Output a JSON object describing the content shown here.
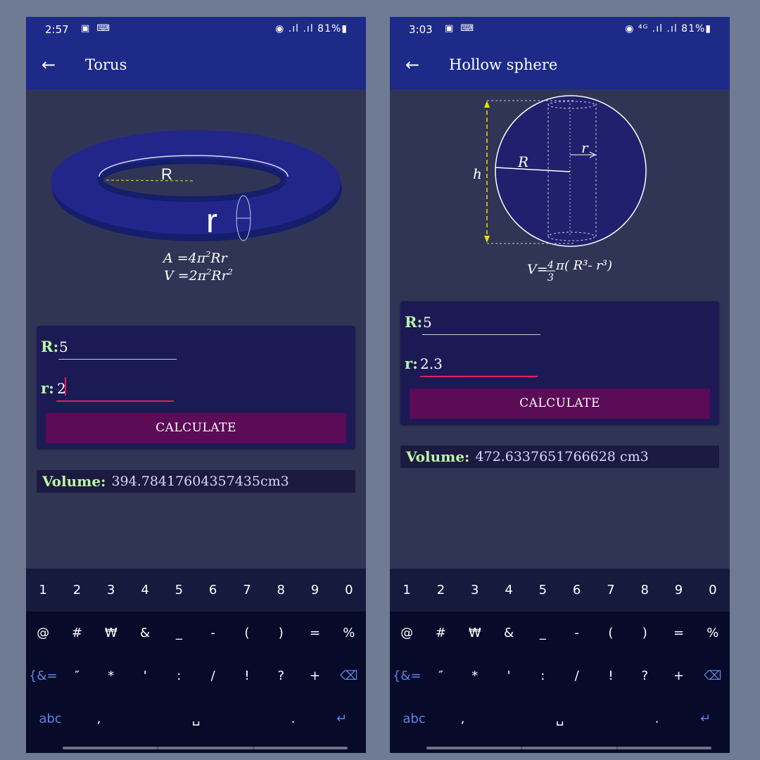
{
  "left": {
    "status": {
      "time": "2:57",
      "icons": "▣ ⌨",
      "system": "◉ .ıl .ıl 81%▮"
    },
    "appbar": {
      "back": "←",
      "title": "Torus"
    },
    "figure": {
      "big_r": "R",
      "small_r": "r",
      "formula_a_lhs": "A =4π",
      "formula_a_rhs": "Rr",
      "formula_v_lhs": "V =2π",
      "formula_v_rhs": "Rr",
      "sup2": "2"
    },
    "fields": [
      {
        "label": "R:",
        "value": "5"
      },
      {
        "label": "r:",
        "value": "2"
      }
    ],
    "button": "CALCULATE",
    "result": {
      "label": "Volume:",
      "value": "394.78417604357435cm3"
    }
  },
  "right": {
    "status": {
      "time": "3:03",
      "icons": "▣ ⌨",
      "system": "◉ ⁴ᴳ .ıl .ıl 81%▮"
    },
    "appbar": {
      "back": "←",
      "title": "Hollow sphere"
    },
    "figure": {
      "h": "h",
      "big_r": "R",
      "small_r": "r",
      "formula": "V=4π( R³- r³)",
      "formula_v": "V=",
      "formula_num": "4",
      "formula_den": "3",
      "formula_rest": "π( R³- r³)"
    },
    "fields": [
      {
        "label": "R:",
        "value": "5"
      },
      {
        "label": "r:",
        "value": "2.3"
      }
    ],
    "button": "CALCULATE",
    "result": {
      "label": "Volume:",
      "value": "472.6337651766628 cm3"
    }
  },
  "keyboard": {
    "numbers": [
      "1",
      "2",
      "3",
      "4",
      "5",
      "6",
      "7",
      "8",
      "9",
      "0"
    ],
    "row2": [
      "@",
      "#",
      "₩",
      "&",
      "_",
      "-",
      "(",
      ")",
      "=",
      "%"
    ],
    "row3": [
      "{&=",
      "″",
      "*",
      "'",
      ":",
      "/",
      "!",
      "?",
      "+",
      "⌫"
    ],
    "row4": [
      "abc",
      ",",
      "␣",
      ".",
      "↵"
    ]
  },
  "colors": {
    "appbar": "#1e2a88",
    "background": "#303556",
    "accent": "#e31d5e",
    "label_green": "#b9f5a4",
    "button": "#5c0b57"
  }
}
